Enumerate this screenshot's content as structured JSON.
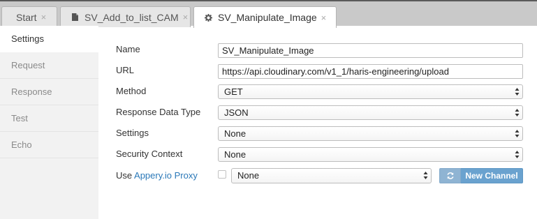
{
  "tabs": [
    {
      "label": "Start",
      "close": "×"
    },
    {
      "label": "SV_Add_to_list_CAM",
      "close": "×",
      "icon": "document-icon"
    },
    {
      "label": "SV_Manipulate_Image",
      "close": "×",
      "icon": "gear-icon",
      "active": true
    }
  ],
  "sidebar": {
    "items": [
      {
        "label": "Settings",
        "active": true
      },
      {
        "label": "Request"
      },
      {
        "label": "Response"
      },
      {
        "label": "Test"
      },
      {
        "label": "Echo"
      }
    ]
  },
  "form": {
    "name": {
      "label": "Name",
      "value": "SV_Manipulate_Image"
    },
    "url": {
      "label": "URL",
      "value": "https://api.cloudinary.com/v1_1/haris-engineering/upload"
    },
    "method": {
      "label": "Method",
      "value": "GET"
    },
    "response_type": {
      "label": "Response Data Type",
      "value": "JSON"
    },
    "settings": {
      "label": "Settings",
      "value": "None"
    },
    "security": {
      "label": "Security Context",
      "value": "None"
    },
    "proxy": {
      "label_prefix": "Use",
      "label_link": "Appery.io Proxy",
      "value": "None",
      "checked": false,
      "button": "New Channel"
    }
  },
  "colors": {
    "accent": "#6aa2cf",
    "link": "#2a78b8"
  }
}
